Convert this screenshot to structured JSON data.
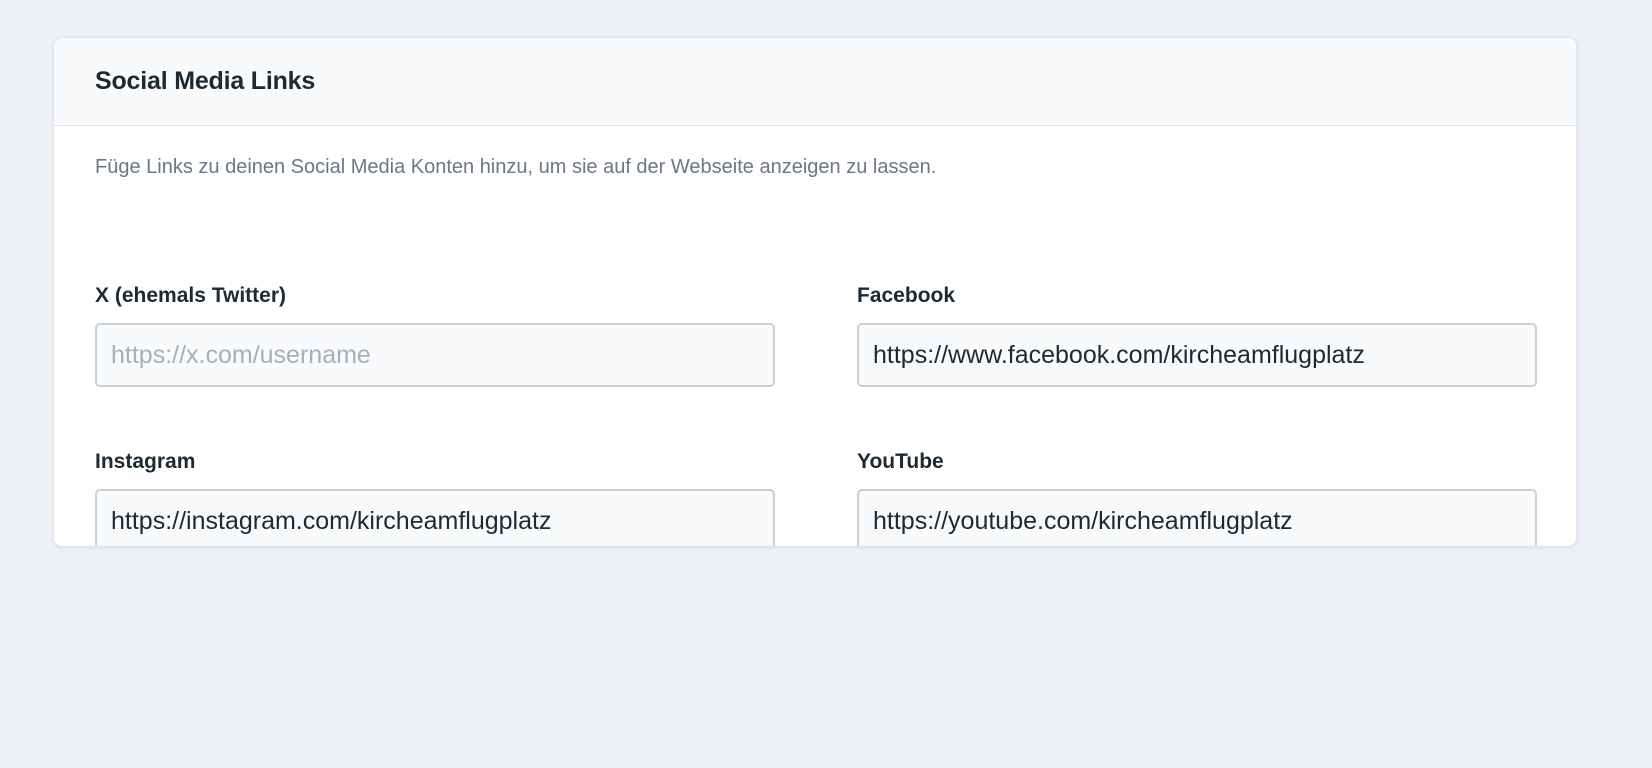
{
  "section": {
    "title": "Social Media Links",
    "description": "Füge Links zu deinen Social Media Konten hinzu, um sie auf der Webseite anzeigen zu lassen."
  },
  "fields": {
    "twitter": {
      "label": "X (ehemals Twitter)",
      "value": "",
      "placeholder": "https://x.com/username"
    },
    "facebook": {
      "label": "Facebook",
      "value": "https://www.facebook.com/kircheamflugplatz",
      "placeholder": ""
    },
    "instagram": {
      "label": "Instagram",
      "value": "https://instagram.com/kircheamflugplatz",
      "placeholder": ""
    },
    "youtube": {
      "label": "YouTube",
      "value": "https://youtube.com/kircheamflugplatz",
      "placeholder": ""
    }
  },
  "colors": {
    "page_background": "#edf0f5",
    "card_background": "#ffffff",
    "header_background": "#f8fafc",
    "heading_text": "#1d2a32",
    "muted_text": "#6b7785",
    "input_border": "#c9d0d8",
    "placeholder_text": "#a6b0bc"
  }
}
